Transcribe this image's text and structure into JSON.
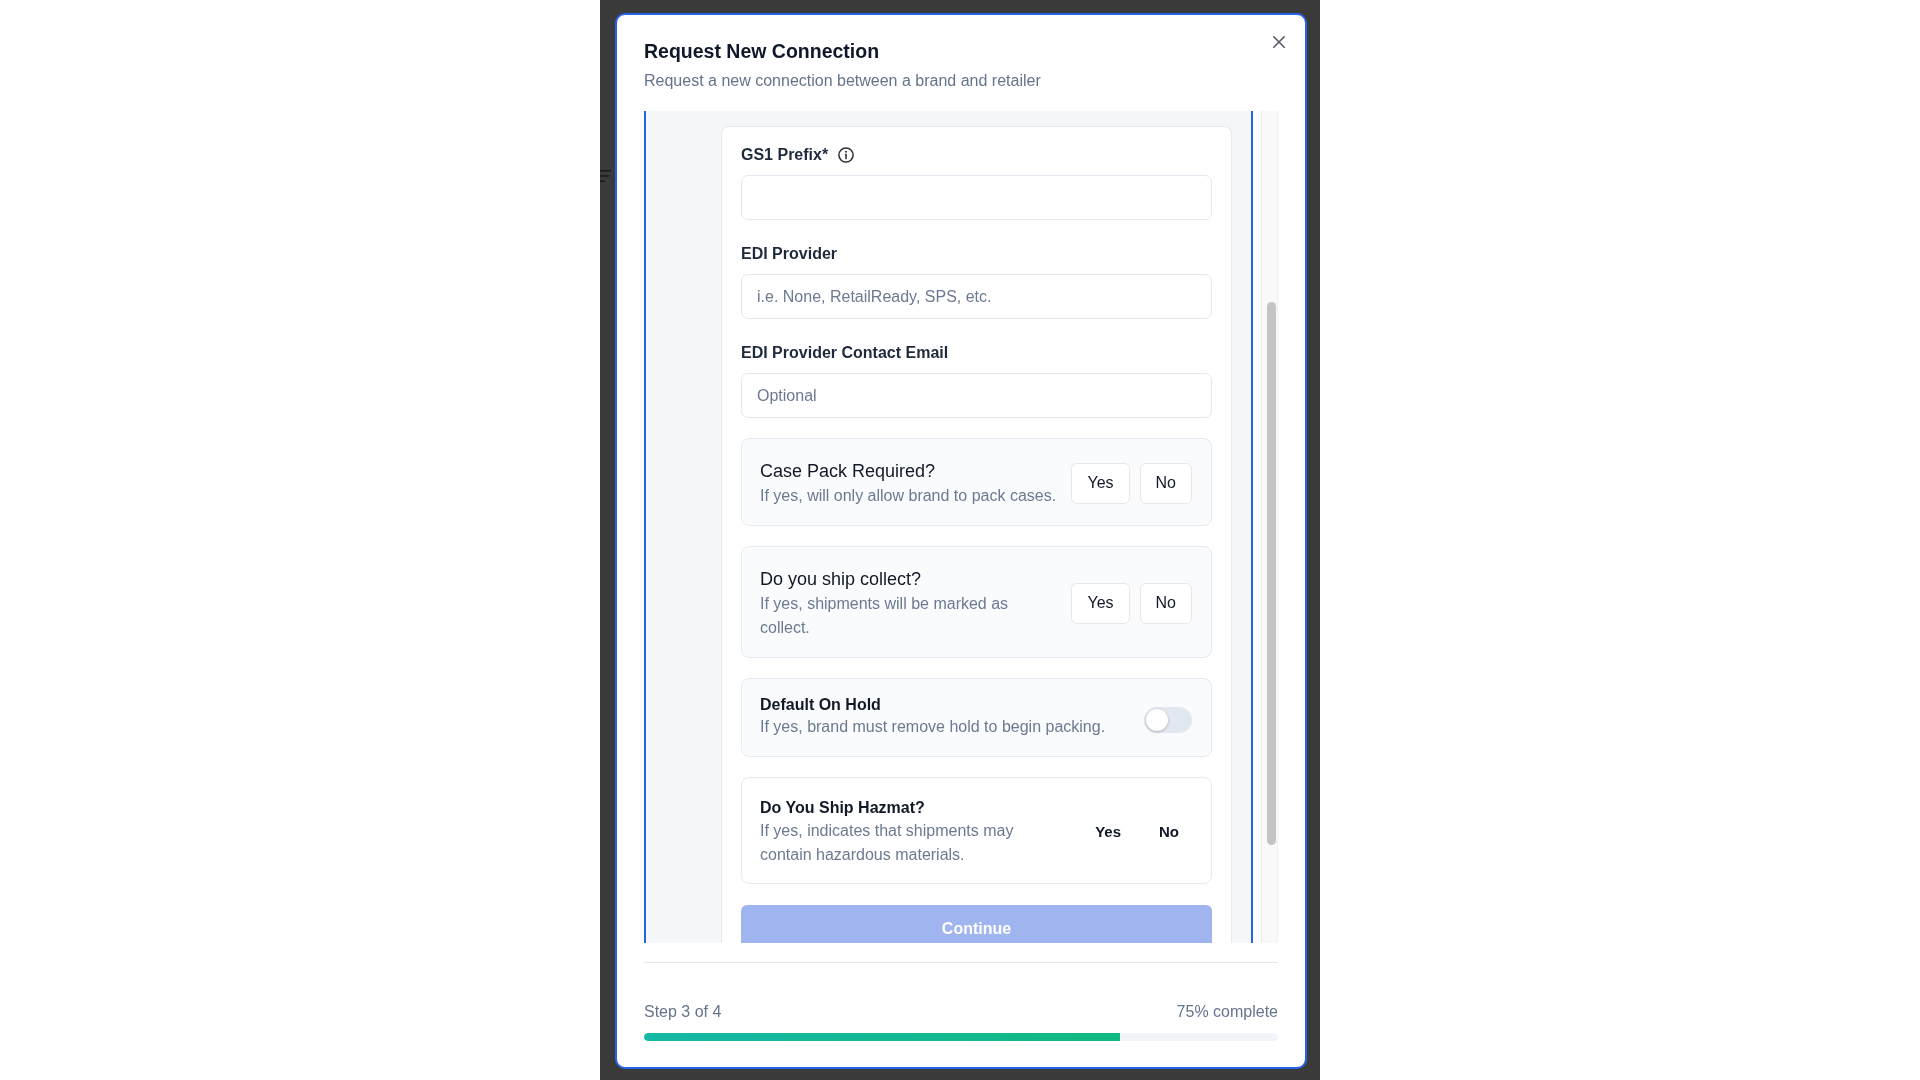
{
  "dialog": {
    "title": "Request New Connection",
    "subtitle": "Request a new connection between a brand and retailer"
  },
  "fields": [
    {
      "label": "GS1 Prefix*",
      "info": true
    },
    {
      "label": "EDI Provider",
      "placeholder": "i.e. None, RetailReady, SPS, etc.",
      "info": false
    },
    {
      "label": "EDI Provider Contact Email",
      "placeholder": "Optional",
      "info": false
    }
  ],
  "questions": [
    {
      "kind": "choice",
      "title": "Case Pack Required?",
      "description": "If yes, will only allow brand to pack cases.",
      "options": [
        {
          "label": "Yes",
          "selected": false
        },
        {
          "label": "No",
          "selected": false
        }
      ]
    },
    {
      "kind": "choice",
      "title": "Do you ship collect?",
      "description": "If yes, shipments will be marked as collect.",
      "options": [
        {
          "label": "Yes",
          "selected": false
        },
        {
          "label": "No",
          "selected": false
        }
      ]
    },
    {
      "kind": "toggle",
      "title": "Default On Hold",
      "description": "If yes, brand must remove hold to begin packing.",
      "on": false
    },
    {
      "kind": "plain",
      "title": "Do You Ship Hazmat?",
      "description": "If yes, indicates that shipments may contain hazardous materials.",
      "options": [
        {
          "label": "Yes",
          "selected": false
        },
        {
          "label": "No",
          "selected": false
        }
      ]
    }
  ],
  "continue_button": {
    "label": "Continue",
    "disabled": true
  },
  "progress": {
    "step": "Step 3 of 4",
    "percent": "75% complete",
    "level": 0.75
  }
}
